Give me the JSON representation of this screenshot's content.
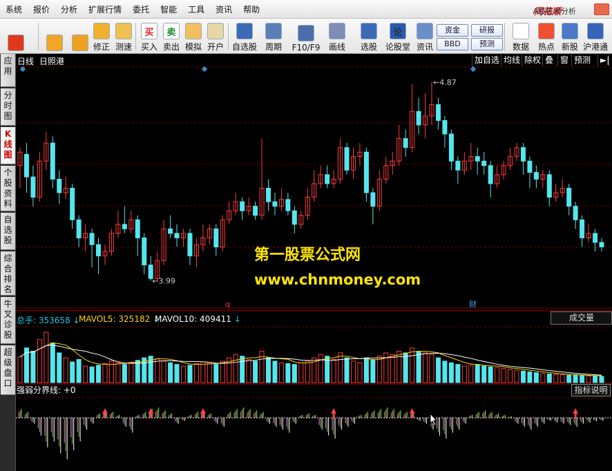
{
  "menu": [
    "系统",
    "报价",
    "分析",
    "扩展行情",
    "委托",
    "智能",
    "工具",
    "资讯",
    "帮助"
  ],
  "brand": {
    "name": "同花顺",
    "subtitle": "A股技术分析"
  },
  "toolbar": {
    "buttons": [
      {
        "label": "",
        "icon": "windows-icon"
      },
      {
        "label": "",
        "icon": "back-arrow-icon"
      },
      {
        "label": "",
        "icon": "up-down-arrows-icon"
      },
      {
        "label": "修正",
        "icon": "correction-icon"
      },
      {
        "label": "测速",
        "icon": "clock-icon"
      },
      {
        "label": "买入",
        "icon": "buy-icon",
        "glyph": "买"
      },
      {
        "label": "卖出",
        "icon": "sell-icon",
        "glyph": "卖"
      },
      {
        "label": "模拟",
        "icon": "hammer-icon"
      },
      {
        "label": "开户",
        "icon": "lock-icon"
      },
      {
        "label": "自选股",
        "icon": "star-icon"
      },
      {
        "label": "周期",
        "icon": "cycle-icon"
      },
      {
        "label": "F10/F9",
        "icon": "f10-icon"
      },
      {
        "label": "画线",
        "icon": "pencil-icon"
      },
      {
        "label": "选股",
        "icon": "select-stock-icon"
      },
      {
        "label": "论股堂",
        "icon": "forum-icon",
        "glyph": "论"
      },
      {
        "label": "资讯",
        "icon": "news-icon"
      },
      {
        "label": "数据",
        "icon": "data-icon"
      },
      {
        "label": "热点",
        "icon": "hot-icon"
      },
      {
        "label": "新股",
        "icon": "new-stock-icon"
      },
      {
        "label": "沪港通",
        "icon": "hk-connect-icon"
      }
    ],
    "small_buttons": [
      "资金",
      "BBD",
      "研报",
      "预测"
    ]
  },
  "left_tabs": [
    "应用",
    "分时图",
    "K线图",
    "个股资料",
    "自选股",
    "综合排名",
    "牛叉诊股",
    "超级盘口"
  ],
  "chart_header": {
    "period": "日线",
    "stock": "日照港",
    "right_buttons": [
      "加自选",
      "均线",
      "除权",
      "叠",
      "窗",
      "预测"
    ]
  },
  "price_labels": {
    "high": "4.87",
    "low": "3.99",
    "marker_q": "q",
    "marker_cai": "财"
  },
  "watermark": {
    "line1": "第一股票公式网",
    "line2": "www.chnmoney.com"
  },
  "volume": {
    "total_label": "总手: 353658",
    "mavol5_label": "MAVOL5: 325182",
    "mavol10_label": "MAVOL10: 409411",
    "selector": "成交量",
    "colors": {
      "total": "#1cc8e8",
      "mavol5": "#ffd700",
      "mavol10": "#ffffff"
    }
  },
  "indicator": {
    "label": "强弱分界线: +0",
    "button": "指标说明"
  },
  "colors": {
    "up": "#ff3b3b",
    "down": "#54e6ee",
    "grid": "#7a0000",
    "accent": "#d42020"
  },
  "chart_data": {
    "type": "candlestick",
    "high_marker": 4.87,
    "low_marker": 3.99,
    "ylim": [
      3.9,
      4.9
    ],
    "candles": [
      [
        4.5,
        4.56,
        4.58,
        4.4
      ],
      [
        4.55,
        4.45,
        4.6,
        4.38
      ],
      [
        4.45,
        4.36,
        4.5,
        4.32
      ],
      [
        4.36,
        4.52,
        4.56,
        4.34
      ],
      [
        4.52,
        4.6,
        4.65,
        4.48
      ],
      [
        4.6,
        4.44,
        4.63,
        4.4
      ],
      [
        4.44,
        4.38,
        4.48,
        4.33
      ],
      [
        4.38,
        4.4,
        4.45,
        4.35
      ],
      [
        4.4,
        4.26,
        4.42,
        4.22
      ],
      [
        4.26,
        4.18,
        4.28,
        4.14
      ],
      [
        4.18,
        4.2,
        4.24,
        4.12
      ],
      [
        4.2,
        4.15,
        4.22,
        4.05
      ],
      [
        4.15,
        4.1,
        4.18,
        4.02
      ],
      [
        4.1,
        4.12,
        4.15,
        4.06
      ],
      [
        4.12,
        4.2,
        4.22,
        4.1
      ],
      [
        4.2,
        4.24,
        4.3,
        4.18
      ],
      [
        4.24,
        4.22,
        4.32,
        4.2
      ],
      [
        4.22,
        4.26,
        4.3,
        4.2
      ],
      [
        4.26,
        4.18,
        4.28,
        4.1
      ],
      [
        4.18,
        4.06,
        4.2,
        4.02
      ],
      [
        4.06,
        4.0,
        4.1,
        3.99
      ],
      [
        4.0,
        4.08,
        4.12,
        3.99
      ],
      [
        4.08,
        4.22,
        4.26,
        4.06
      ],
      [
        4.22,
        4.2,
        4.28,
        4.18
      ],
      [
        4.2,
        4.18,
        4.24,
        4.14
      ],
      [
        4.18,
        4.2,
        4.22,
        4.14
      ],
      [
        4.2,
        4.1,
        4.22,
        4.06
      ],
      [
        4.1,
        4.15,
        4.18,
        4.05
      ],
      [
        4.15,
        4.18,
        4.24,
        4.12
      ],
      [
        4.18,
        4.22,
        4.24,
        4.15
      ],
      [
        4.22,
        4.14,
        4.24,
        4.1
      ],
      [
        4.14,
        4.26,
        4.28,
        4.12
      ],
      [
        4.26,
        4.3,
        4.34,
        4.24
      ],
      [
        4.3,
        4.34,
        4.38,
        4.28
      ],
      [
        4.34,
        4.3,
        4.36,
        4.26
      ],
      [
        4.3,
        4.32,
        4.36,
        4.28
      ],
      [
        4.32,
        4.28,
        4.34,
        4.26
      ],
      [
        4.28,
        4.4,
        4.62,
        4.26
      ],
      [
        4.4,
        4.34,
        4.44,
        4.3
      ],
      [
        4.34,
        4.32,
        4.38,
        4.28
      ],
      [
        4.32,
        4.35,
        4.4,
        4.3
      ],
      [
        4.35,
        4.3,
        4.38,
        4.28
      ],
      [
        4.3,
        4.24,
        4.32,
        4.2
      ],
      [
        4.24,
        4.28,
        4.3,
        4.22
      ],
      [
        4.28,
        4.36,
        4.4,
        4.26
      ],
      [
        4.36,
        4.42,
        4.48,
        4.34
      ],
      [
        4.42,
        4.46,
        4.5,
        4.4
      ],
      [
        4.46,
        4.42,
        4.5,
        4.4
      ],
      [
        4.42,
        4.44,
        4.48,
        4.4
      ],
      [
        4.44,
        4.58,
        4.62,
        4.42
      ],
      [
        4.58,
        4.48,
        4.6,
        4.46
      ],
      [
        4.48,
        4.54,
        4.58,
        4.44
      ],
      [
        4.54,
        4.56,
        4.6,
        4.5
      ],
      [
        4.56,
        4.38,
        4.58,
        4.34
      ],
      [
        4.38,
        4.32,
        4.4,
        4.24
      ],
      [
        4.32,
        4.44,
        4.48,
        4.3
      ],
      [
        4.44,
        4.5,
        4.54,
        4.42
      ],
      [
        4.5,
        4.52,
        4.56,
        4.46
      ],
      [
        4.52,
        4.62,
        4.68,
        4.5
      ],
      [
        4.62,
        4.58,
        4.66,
        4.54
      ],
      [
        4.58,
        4.74,
        4.86,
        4.56
      ],
      [
        4.74,
        4.68,
        4.8,
        4.64
      ],
      [
        4.68,
        4.72,
        4.82,
        4.62
      ],
      [
        4.72,
        4.77,
        4.87,
        4.68
      ],
      [
        4.77,
        4.7,
        4.8,
        4.66
      ],
      [
        4.7,
        4.64,
        4.72,
        4.58
      ],
      [
        4.64,
        4.52,
        4.66,
        4.48
      ],
      [
        4.52,
        4.48,
        4.54,
        4.42
      ],
      [
        4.48,
        4.52,
        4.56,
        4.46
      ],
      [
        4.52,
        4.54,
        4.6,
        4.48
      ],
      [
        4.54,
        4.52,
        4.58,
        4.46
      ],
      [
        4.52,
        4.5,
        4.56,
        4.46
      ],
      [
        4.5,
        4.42,
        4.52,
        4.36
      ],
      [
        4.42,
        4.46,
        4.5,
        4.4
      ],
      [
        4.46,
        4.5,
        4.52,
        4.44
      ],
      [
        4.5,
        4.54,
        4.58,
        4.48
      ],
      [
        4.54,
        4.58,
        4.6,
        4.52
      ],
      [
        4.58,
        4.52,
        4.6,
        4.46
      ],
      [
        4.52,
        4.47,
        4.54,
        4.4
      ],
      [
        4.47,
        4.44,
        4.5,
        4.4
      ],
      [
        4.44,
        4.46,
        4.48,
        4.4
      ],
      [
        4.46,
        4.36,
        4.48,
        4.32
      ],
      [
        4.36,
        4.38,
        4.42,
        4.34
      ],
      [
        4.38,
        4.4,
        4.44,
        4.36
      ],
      [
        4.4,
        4.32,
        4.42,
        4.28
      ],
      [
        4.32,
        4.26,
        4.34,
        4.22
      ],
      [
        4.26,
        4.18,
        4.28,
        4.14
      ],
      [
        4.18,
        4.2,
        4.24,
        4.16
      ],
      [
        4.2,
        4.16,
        4.22,
        4.12
      ],
      [
        4.16,
        4.14,
        4.18,
        4.12
      ]
    ],
    "volume": [
      310,
      420,
      380,
      520,
      610,
      480,
      360,
      300,
      250,
      280,
      200,
      190,
      210,
      230,
      260,
      240,
      220,
      250,
      270,
      300,
      320,
      290,
      260,
      240,
      220,
      200,
      210,
      230,
      250,
      240,
      220,
      260,
      300,
      340,
      320,
      280,
      260,
      380,
      300,
      260,
      240,
      230,
      220,
      240,
      260,
      300,
      340,
      320,
      280,
      360,
      300,
      260,
      240,
      300,
      280,
      320,
      360,
      340,
      380,
      360,
      420,
      380,
      360,
      340,
      300,
      260,
      240,
      220,
      200,
      210,
      220,
      200,
      190,
      180,
      170,
      160,
      150,
      140,
      130,
      120,
      110,
      105,
      100,
      95,
      90,
      88,
      85,
      80,
      78,
      75
    ],
    "indicator": [
      30,
      20,
      -10,
      -30,
      -50,
      -40,
      -60,
      -70,
      -55,
      -40,
      -20,
      -10,
      15,
      25,
      20,
      10,
      -15,
      -25,
      10,
      20,
      30,
      35,
      25,
      15,
      -10,
      -5,
      10,
      20,
      25,
      15,
      -10,
      -15,
      20,
      30,
      35,
      30,
      25,
      20,
      -10,
      -15,
      -20,
      -25,
      -10,
      10,
      15,
      10,
      -20,
      -30,
      -35,
      -20,
      -15,
      -10,
      10,
      20,
      25,
      30,
      35,
      30,
      25,
      20,
      15,
      -5,
      -10,
      -20,
      -30,
      -35,
      -25,
      -20,
      -10,
      10,
      20,
      25,
      20,
      15,
      10,
      5,
      -10,
      -15,
      -20,
      -15,
      -10,
      -5,
      -8,
      -10,
      -12,
      -15,
      -10,
      -8,
      -6,
      -5
    ],
    "buy_signals": [
      13,
      20,
      28,
      48,
      60,
      85
    ]
  }
}
